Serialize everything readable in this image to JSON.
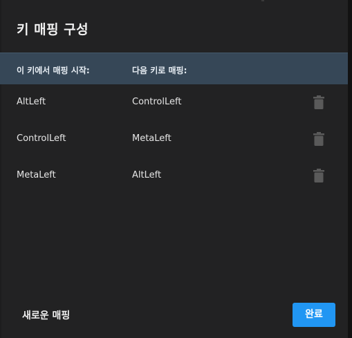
{
  "dialog": {
    "title": "키 매핑 구성"
  },
  "table": {
    "headers": {
      "from": "이 키에서 매핑 시작:",
      "to": "다음 키로 매핑:"
    },
    "rows": [
      {
        "from": "AltLeft",
        "to": "ControlLeft",
        "action_icon": "trash-icon"
      },
      {
        "from": "ControlLeft",
        "to": "MetaLeft",
        "action_icon": "trash-icon"
      },
      {
        "from": "MetaLeft",
        "to": "AltLeft",
        "action_icon": "trash-icon"
      }
    ]
  },
  "footer": {
    "new_mapping_label": "새로운 매핑",
    "done_label": "완료"
  },
  "colors": {
    "dialog_bg": "#222223",
    "header_bg": "#364757",
    "primary_button": "#2196f3",
    "trash_icon": "#5a5a5a"
  }
}
